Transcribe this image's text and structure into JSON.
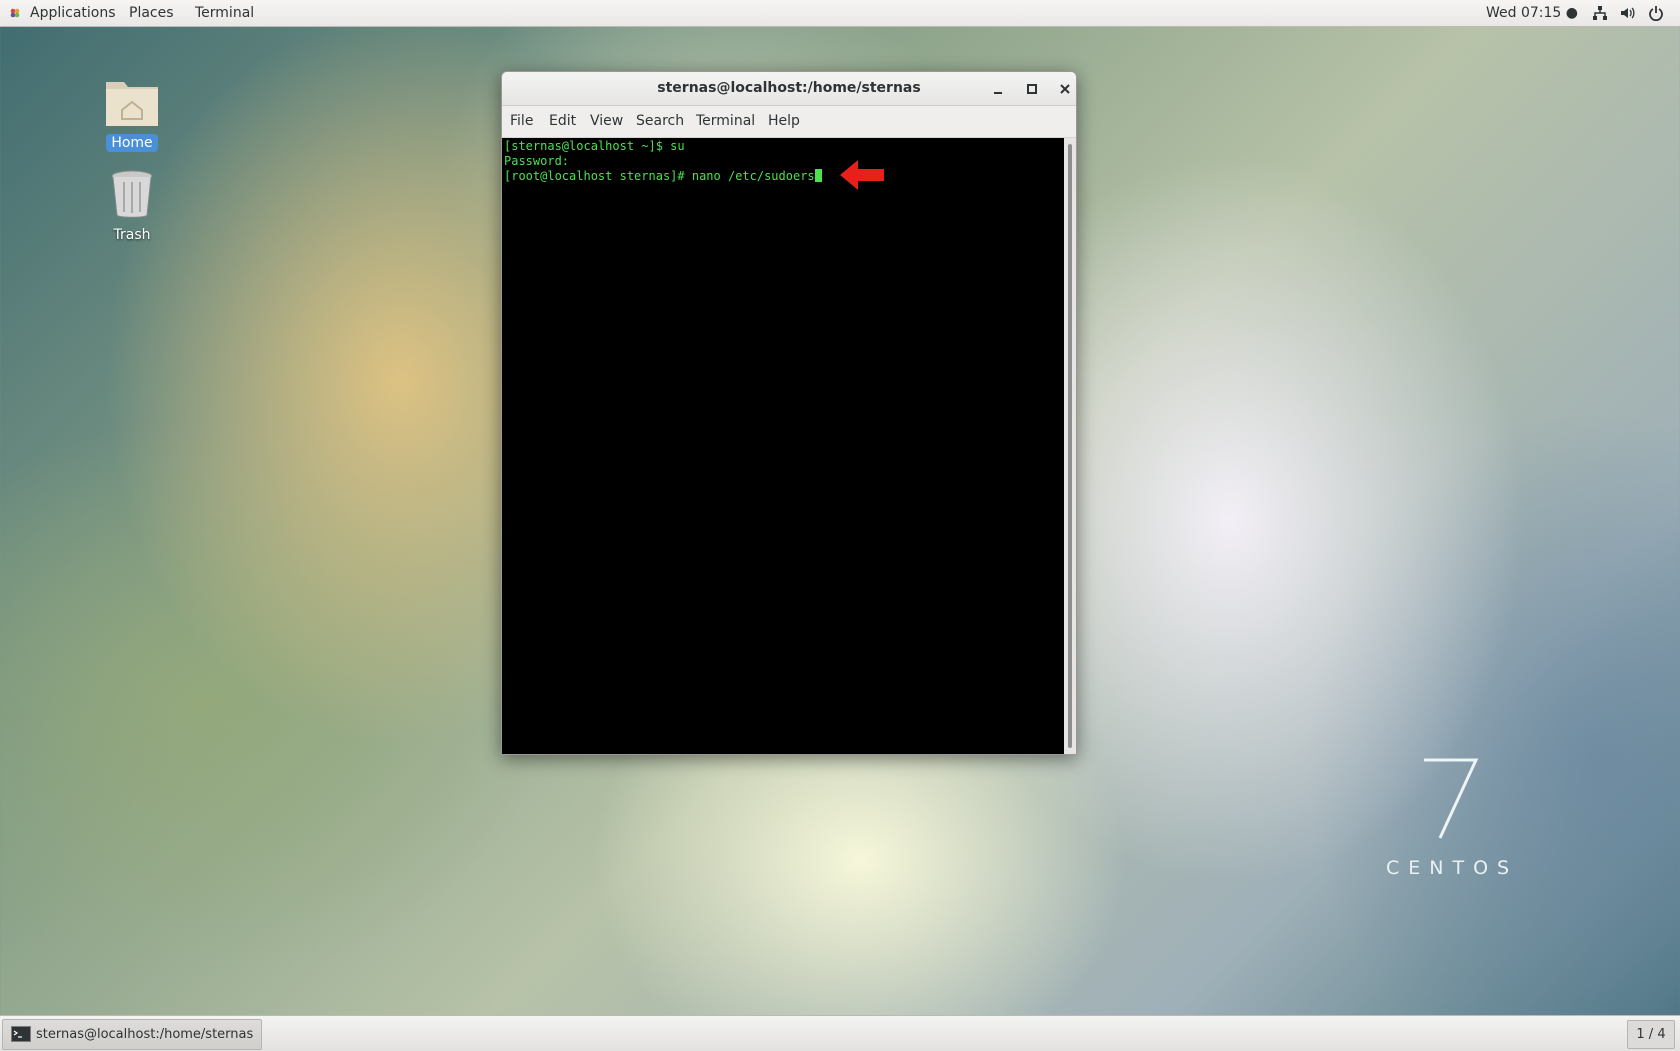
{
  "topbar": {
    "applications": "Applications",
    "places": "Places",
    "terminal": "Terminal",
    "clock": "Wed 07:15 ●",
    "icons": [
      "network-icon",
      "volume-icon",
      "power-icon"
    ]
  },
  "desktop": {
    "icons": [
      {
        "label": "Home",
        "icon": "home-folder-icon"
      },
      {
        "label": "Trash",
        "icon": "trash-icon"
      }
    ],
    "brand": {
      "numeral": "7",
      "word": "CENTOS"
    }
  },
  "window": {
    "title": "sternas@localhost:/home/sternas",
    "menu": [
      "File",
      "Edit",
      "View",
      "Search",
      "Terminal",
      "Help"
    ],
    "terminal_lines": [
      "[sternas@localhost ~]$ su",
      "Password: ",
      "[root@localhost sternas]# nano /etc/sudoers"
    ],
    "text_color": "#4ee04e",
    "annotation": {
      "icon": "red-arrow-icon",
      "color": "#e8201c"
    }
  },
  "taskbar": {
    "task_label": "sternas@localhost:/home/sternas",
    "workspace": "1 / 4"
  }
}
